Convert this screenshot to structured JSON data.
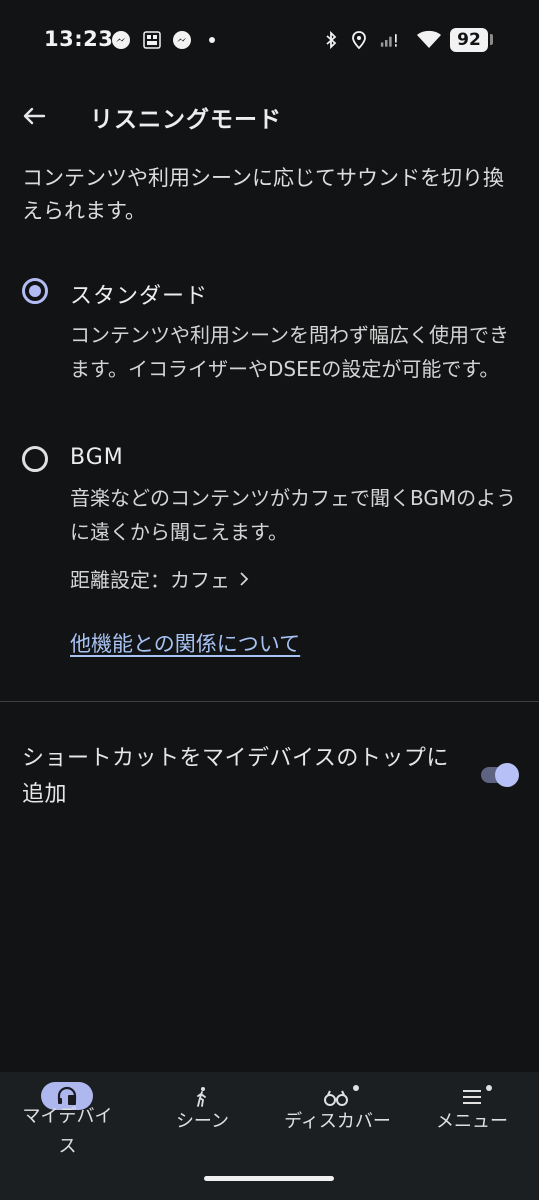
{
  "status_bar": {
    "time": "13:23",
    "battery": "92",
    "icons": [
      "messenger-icon",
      "manga-app-icon",
      "messenger-icon",
      "dot-icon",
      "bluetooth-icon",
      "location-icon",
      "signal-icon",
      "wifi-icon"
    ]
  },
  "header": {
    "back_icon": "arrow-left-icon",
    "title": "リスニングモード"
  },
  "intro": "コンテンツや利用シーンに応じてサウンドを切り換えられます。",
  "options": [
    {
      "title": "スタンダード",
      "selected": true,
      "description": "コンテンツや利用シーンを問わず幅広く使用できます。イコライザーやDSEEの設定が可能です。"
    },
    {
      "title": "BGM",
      "selected": false,
      "description": "音楽などのコンテンツがカフェで聞くBGMのように遠くから聞こえます。"
    }
  ],
  "distance_setting": "距離設定：カフェ",
  "related_link": "他機能との関係について",
  "shortcut": {
    "label": "ショートカットをマイデバイスのトップに追加",
    "enabled": true
  },
  "bottom_nav": [
    {
      "label": "マイデバイス",
      "icon": "headphones-device-icon",
      "active": true
    },
    {
      "label": "シーン",
      "icon": "walking-person-icon",
      "active": false
    },
    {
      "label": "ディスカバー",
      "icon": "binoculars-icon",
      "active": false
    },
    {
      "label": "メニュー",
      "icon": "menu-icon",
      "active": false
    }
  ],
  "colors": {
    "background": "#111314",
    "accent": "#b2bcf3",
    "link": "#a8c2f2",
    "nav_background": "#1c1f22"
  }
}
